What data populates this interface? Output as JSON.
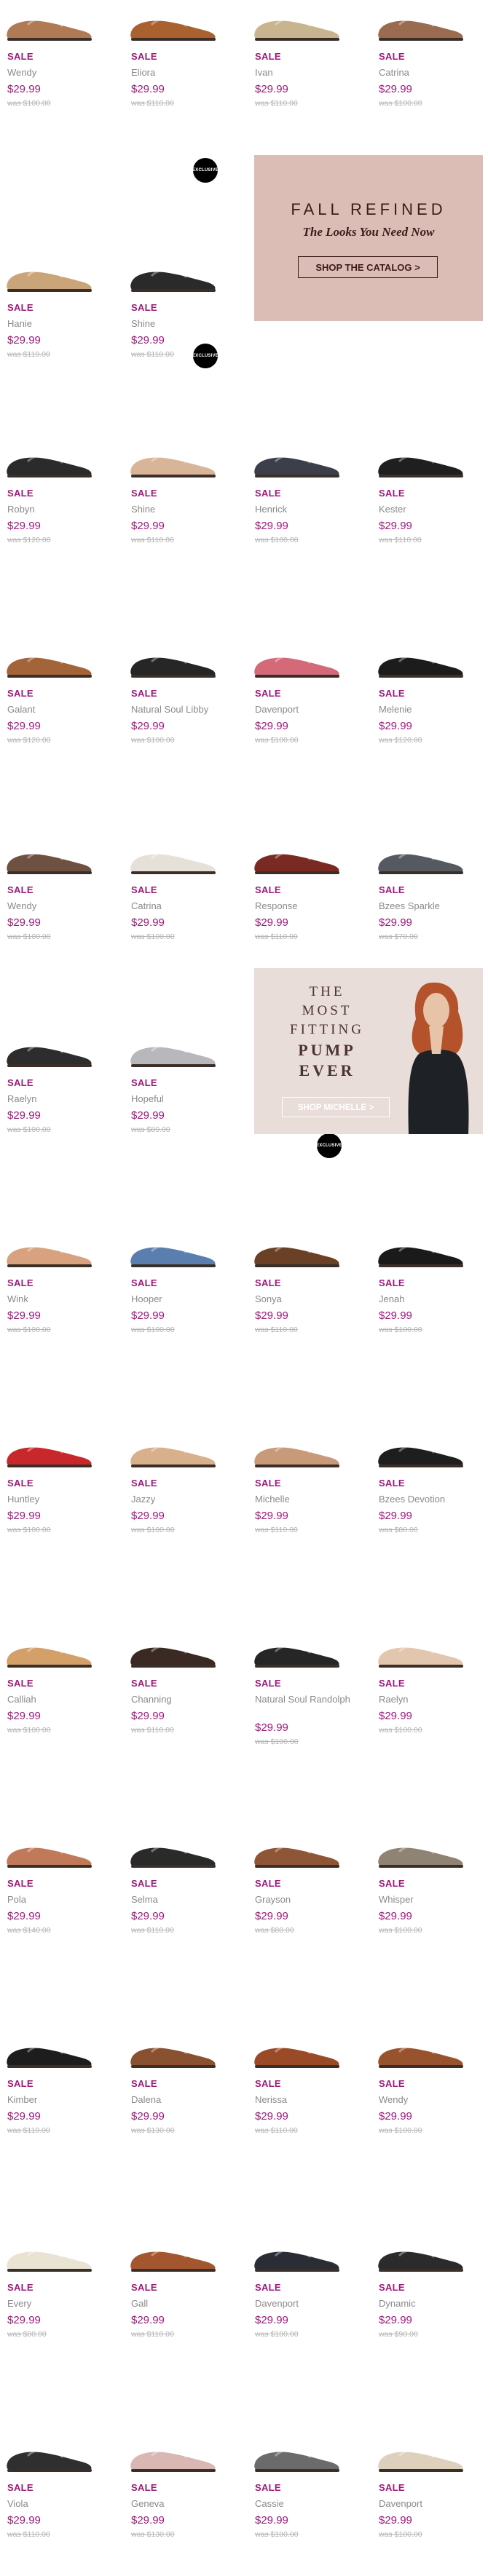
{
  "badge_label": "EXCLUSIVE",
  "promos": {
    "fall": {
      "title": "FALL REFINED",
      "subtitle": "The Looks You Need Now",
      "button": "SHOP THE CATALOG >"
    },
    "pump": {
      "line1": "THE",
      "line2": "MOST",
      "line3": "FITTING",
      "line4": "PUMP",
      "line5": "EVER",
      "button": "SHOP MICHELLE >"
    }
  },
  "products": [
    {
      "sale": "SALE",
      "name": "Wendy",
      "price": "$29.99",
      "was": "was $100.00",
      "color": "#b07a55"
    },
    {
      "sale": "SALE",
      "name": "Eliora",
      "price": "$29.99",
      "was": "was $110.00",
      "color": "#a8612f"
    },
    {
      "sale": "SALE",
      "name": "Ivan",
      "price": "$29.99",
      "was": "was $110.00",
      "color": "#c8b48e"
    },
    {
      "sale": "SALE",
      "name": "Catrina",
      "price": "$29.99",
      "was": "was $100.00",
      "color": "#9b6b50"
    },
    {
      "sale": "SALE",
      "name": "Hanie",
      "price": "$29.99",
      "was": "was $110.00",
      "color": "#caa57a"
    },
    {
      "sale": "SALE",
      "name": "Shine",
      "price": "$29.99",
      "was": "was $110.00",
      "color": "#2a2a2a"
    },
    {
      "sale": "SALE",
      "name": "Robyn",
      "price": "$29.99",
      "was": "was $120.00",
      "color": "#2b2b2b"
    },
    {
      "sale": "SALE",
      "name": "Shine",
      "price": "$29.99",
      "was": "was $110.00",
      "color": "#d8b598"
    },
    {
      "sale": "SALE",
      "name": "Henrick",
      "price": "$29.99",
      "was": "was $100.00",
      "color": "#3c3f4a"
    },
    {
      "sale": "SALE",
      "name": "Kester",
      "price": "$29.99",
      "was": "was $110.00",
      "color": "#1f1f1f"
    },
    {
      "sale": "SALE",
      "name": "Galant",
      "price": "$29.99",
      "was": "was $120.00",
      "color": "#a3643a"
    },
    {
      "sale": "SALE",
      "name": "Natural Soul Libby",
      "price": "$29.99",
      "was": "was $100.00",
      "color": "#262626"
    },
    {
      "sale": "SALE",
      "name": "Davenport",
      "price": "$29.99",
      "was": "was $100.00",
      "color": "#d46a78"
    },
    {
      "sale": "SALE",
      "name": "Melenie",
      "price": "$29.99",
      "was": "was $120.00",
      "color": "#1c1c1c"
    },
    {
      "sale": "SALE",
      "name": "Wendy",
      "price": "$29.99",
      "was": "was $100.00",
      "color": "#6e5141"
    },
    {
      "sale": "SALE",
      "name": "Catrina",
      "price": "$29.99",
      "was": "was $100.00",
      "color": "#e6e1d8"
    },
    {
      "sale": "SALE",
      "name": "Response",
      "price": "$29.99",
      "was": "was $110.00",
      "color": "#7a2a22"
    },
    {
      "sale": "SALE",
      "name": "Bzees Sparkle",
      "price": "$29.99",
      "was": "was $70.00",
      "color": "#555a60"
    },
    {
      "sale": "SALE",
      "name": "Raelyn",
      "price": "$29.99",
      "was": "was $100.00",
      "color": "#2d2d2d"
    },
    {
      "sale": "SALE",
      "name": "Hopeful",
      "price": "$29.99",
      "was": "was $80.00",
      "color": "#b8b8bc"
    },
    {
      "sale": "SALE",
      "name": "Wink",
      "price": "$29.99",
      "was": "was $100.00",
      "color": "#d7a27d"
    },
    {
      "sale": "SALE",
      "name": "Hooper",
      "price": "$29.99",
      "was": "was $100.00",
      "color": "#5a7fae"
    },
    {
      "sale": "SALE",
      "name": "Sonya",
      "price": "$29.99",
      "was": "was $110.00",
      "color": "#6b4126"
    },
    {
      "sale": "SALE",
      "name": "Jenah",
      "price": "$29.99",
      "was": "was $100.00",
      "color": "#1a1a1a"
    },
    {
      "sale": "SALE",
      "name": "Huntley",
      "price": "$29.99",
      "was": "was $100.00",
      "color": "#c8282c"
    },
    {
      "sale": "SALE",
      "name": "Jazzy",
      "price": "$29.99",
      "was": "was $100.00",
      "color": "#d9b08c"
    },
    {
      "sale": "SALE",
      "name": "Michelle",
      "price": "$29.99",
      "was": "was $110.00",
      "color": "#c89a7a"
    },
    {
      "sale": "SALE",
      "name": "Bzees Devotion",
      "price": "$29.99",
      "was": "was $80.00",
      "color": "#1e1e1e"
    },
    {
      "sale": "SALE",
      "name": "Calliah",
      "price": "$29.99",
      "was": "was $100.00",
      "color": "#d3a06a"
    },
    {
      "sale": "SALE",
      "name": "Channing",
      "price": "$29.99",
      "was": "was $110.00",
      "color": "#3b2a24"
    },
    {
      "sale": "SALE",
      "name": "Natural Soul Randolph",
      "price": "$29.99",
      "was": "was $100.00",
      "color": "#262626"
    },
    {
      "sale": "SALE",
      "name": "Raelyn",
      "price": "$29.99",
      "was": "was $100.00",
      "color": "#e2c6ad"
    },
    {
      "sale": "SALE",
      "name": "Pola",
      "price": "$29.99",
      "was": "was $140.00",
      "color": "#c07a5a"
    },
    {
      "sale": "SALE",
      "name": "Selma",
      "price": "$29.99",
      "was": "was $110.00",
      "color": "#2a2a2a"
    },
    {
      "sale": "SALE",
      "name": "Grayson",
      "price": "$29.99",
      "was": "was $80.00",
      "color": "#8e5536"
    },
    {
      "sale": "SALE",
      "name": "Whisper",
      "price": "$29.99",
      "was": "was $100.00",
      "color": "#8f8373"
    },
    {
      "sale": "SALE",
      "name": "Kimber",
      "price": "$29.99",
      "was": "was $110.00",
      "color": "#1d1d1d"
    },
    {
      "sale": "SALE",
      "name": "Dalena",
      "price": "$29.99",
      "was": "was $130.00",
      "color": "#8a5130"
    },
    {
      "sale": "SALE",
      "name": "Nerissa",
      "price": "$29.99",
      "was": "was $110.00",
      "color": "#9b4a27"
    },
    {
      "sale": "SALE",
      "name": "Wendy",
      "price": "$29.99",
      "was": "was $100.00",
      "color": "#99522e"
    },
    {
      "sale": "SALE",
      "name": "Every",
      "price": "$29.99",
      "was": "was $80.00",
      "color": "#e9e3d3"
    },
    {
      "sale": "SALE",
      "name": "Gall",
      "price": "$29.99",
      "was": "was $110.00",
      "color": "#a4572f"
    },
    {
      "sale": "SALE",
      "name": "Davenport",
      "price": "$29.99",
      "was": "was $100.00",
      "color": "#2a2d33"
    },
    {
      "sale": "SALE",
      "name": "Dynamic",
      "price": "$29.99",
      "was": "was $90.00",
      "color": "#2b2b2b"
    },
    {
      "sale": "SALE",
      "name": "Viola",
      "price": "$29.99",
      "was": "was $110.00",
      "color": "#2f2f2f"
    },
    {
      "sale": "SALE",
      "name": "Geneva",
      "price": "$29.99",
      "was": "was $130.00",
      "color": "#d9b7b3"
    },
    {
      "sale": "SALE",
      "name": "Cassie",
      "price": "$29.99",
      "was": "was $100.00",
      "color": "#6b6b6b"
    },
    {
      "sale": "SALE",
      "name": "Davenport",
      "price": "$29.99",
      "was": "was $100.00",
      "color": "#ddd1be"
    }
  ]
}
